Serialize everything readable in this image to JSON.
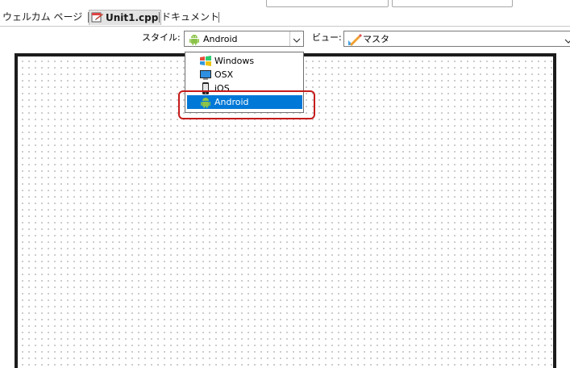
{
  "tabs": [
    {
      "label": "ウェルカム ページ",
      "active": false
    },
    {
      "label": "Unit1.cpp",
      "active": true,
      "icon": "cpp-file-icon"
    },
    {
      "label": "ドキュメント",
      "active": false
    }
  ],
  "toolbar": {
    "style_label": "スタイル:",
    "style_value": "Android",
    "style_icon": "android-icon",
    "view_label": "ビュー:",
    "view_value": "マスタ",
    "view_icon": "master-view-icon"
  },
  "style_dropdown": {
    "options": [
      {
        "label": "Windows",
        "icon": "windows-icon"
      },
      {
        "label": "OSX",
        "icon": "osx-icon"
      },
      {
        "label": "iOS",
        "icon": "ios-icon"
      },
      {
        "label": "Android",
        "icon": "android-icon"
      }
    ],
    "selected": "Android"
  },
  "colors": {
    "selection": "#0078d7",
    "highlight_box": "#c61b1b",
    "android_green": "#8bc34a"
  }
}
